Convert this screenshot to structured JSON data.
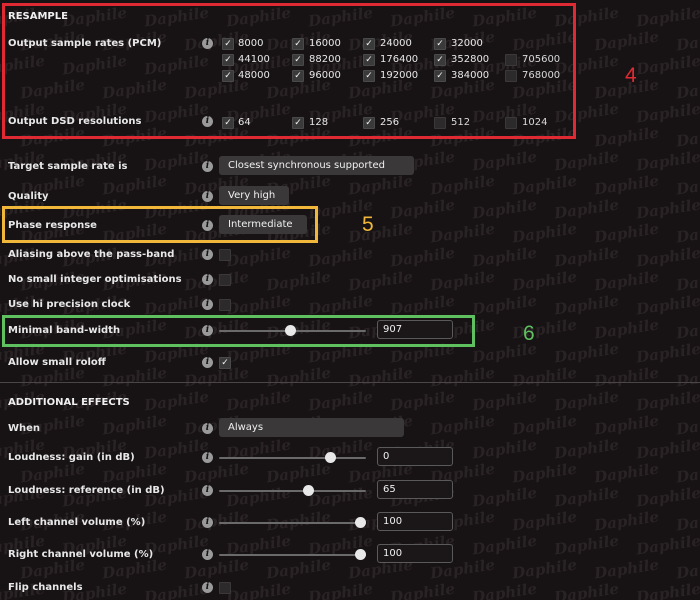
{
  "resample": {
    "title": "RESAMPLE",
    "output_sample_rates": {
      "label": "Output sample rates (PCM)",
      "rates": [
        {
          "value": "8000",
          "checked": true
        },
        {
          "value": "16000",
          "checked": true
        },
        {
          "value": "24000",
          "checked": true
        },
        {
          "value": "32000",
          "checked": true
        },
        {
          "value": "44100",
          "checked": true
        },
        {
          "value": "88200",
          "checked": true
        },
        {
          "value": "176400",
          "checked": true
        },
        {
          "value": "352800",
          "checked": true
        },
        {
          "value": "705600",
          "checked": false
        },
        {
          "value": "48000",
          "checked": true
        },
        {
          "value": "96000",
          "checked": true
        },
        {
          "value": "192000",
          "checked": true
        },
        {
          "value": "384000",
          "checked": true
        },
        {
          "value": "768000",
          "checked": false
        }
      ]
    },
    "output_dsd": {
      "label": "Output DSD resolutions",
      "resolutions": [
        {
          "value": "64",
          "checked": true
        },
        {
          "value": "128",
          "checked": true
        },
        {
          "value": "256",
          "checked": true
        },
        {
          "value": "512",
          "checked": false
        },
        {
          "value": "1024",
          "checked": false
        }
      ]
    },
    "target_sample_rate": {
      "label": "Target sample rate is",
      "value": "Closest synchronous supported"
    },
    "quality": {
      "label": "Quality",
      "value": "Very high"
    },
    "phase_response": {
      "label": "Phase response",
      "value": "Intermediate"
    },
    "aliasing": {
      "label": "Aliasing above the pass-band",
      "checked": false
    },
    "no_small_int": {
      "label": "No small integer optimisations",
      "checked": false
    },
    "hi_precision": {
      "label": "Use hi precision clock",
      "checked": false
    },
    "minimal_bandwidth": {
      "label": "Minimal band-width",
      "value": "907",
      "fraction": 0.485
    },
    "allow_small_roloff": {
      "label": "Allow small roloff",
      "checked": true
    }
  },
  "effects": {
    "title": "ADDITIONAL EFFECTS",
    "when": {
      "label": "When",
      "value": "Always"
    },
    "loudness_gain": {
      "label": "Loudness: gain (in dB)",
      "value": "0",
      "fraction": 0.78
    },
    "loudness_reference": {
      "label": "Loudness: reference (in dB)",
      "value": "65",
      "fraction": 0.62
    },
    "left_volume": {
      "label": "Left channel volume (%)",
      "value": "100",
      "fraction": 1.0
    },
    "right_volume": {
      "label": "Right channel volume (%)",
      "value": "100",
      "fraction": 1.0
    },
    "flip_channels": {
      "label": "Flip channels",
      "checked": false
    }
  },
  "watermark": {
    "text": "Daphile"
  },
  "annotations": [
    {
      "label": "4",
      "color": "#e02a33"
    },
    {
      "label": "5",
      "color": "#f0b73a"
    },
    {
      "label": "6",
      "color": "#5ec05f"
    }
  ],
  "icons": {
    "info": "i",
    "check": "✓"
  }
}
